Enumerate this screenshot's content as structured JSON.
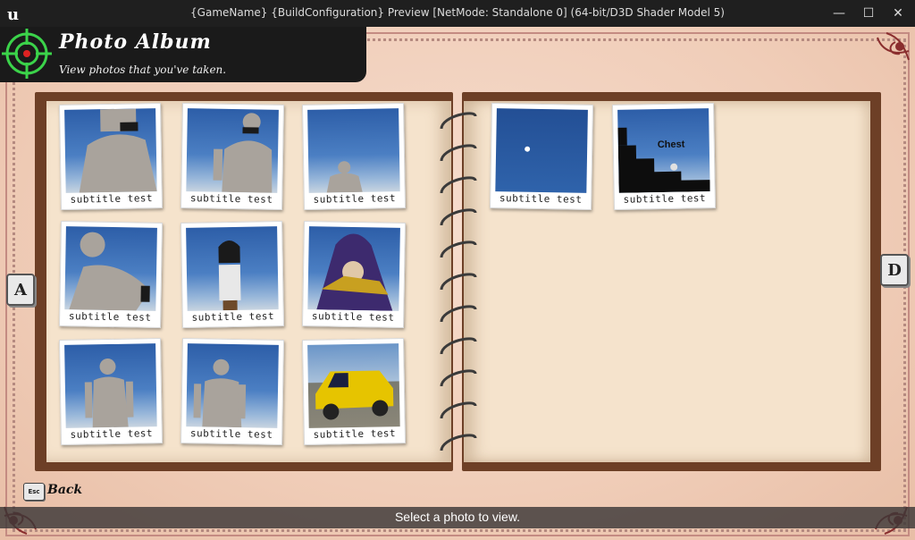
{
  "window": {
    "title": "{GameName} {BuildConfiguration} Preview [NetMode: Standalone 0]  (64-bit/D3D Shader Model 5)",
    "minimize": "—",
    "maximize": "☐",
    "close": "✕"
  },
  "header": {
    "title": "Photo Album",
    "subtitle": "View photos that you've taken."
  },
  "nav": {
    "prev_key": "A",
    "next_key": "D"
  },
  "footer": {
    "esc_key": "Esc",
    "back_label": "Back",
    "status": "Select a photo to view."
  },
  "photos_left": [
    {
      "caption": "subtitle test",
      "scene": "mannequin-close"
    },
    {
      "caption": "subtitle test",
      "scene": "mannequin-full"
    },
    {
      "caption": "subtitle test",
      "scene": "mannequin-far"
    },
    {
      "caption": "subtitle test",
      "scene": "mannequin-side"
    },
    {
      "caption": "subtitle test",
      "scene": "character"
    },
    {
      "caption": "subtitle test",
      "scene": "wizard"
    },
    {
      "caption": "subtitle test",
      "scene": "mannequin-stand"
    },
    {
      "caption": "subtitle test",
      "scene": "mannequin-stand2"
    },
    {
      "caption": "subtitle test",
      "scene": "yellow-car"
    }
  ],
  "photos_right": [
    {
      "caption": "subtitle test",
      "scene": "sky-sun"
    },
    {
      "caption": "subtitle test",
      "scene": "chest",
      "label": "Chest"
    }
  ],
  "colors": {
    "page": "#f5e3cc",
    "book_cover": "#6d3f26",
    "background": "#f0cdb8",
    "header_bg": "#1a1a1a",
    "target_icon": "#3bd34a"
  }
}
